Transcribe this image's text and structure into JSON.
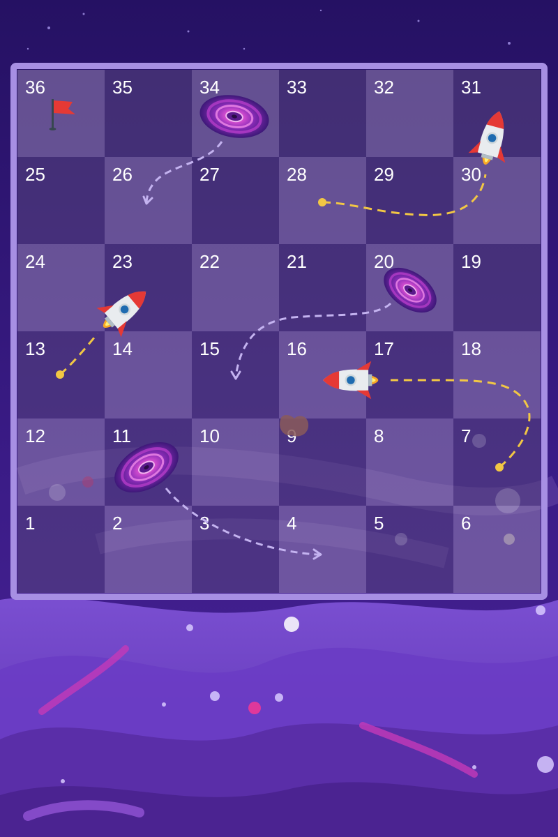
{
  "board": {
    "rows": [
      [
        "36",
        "35",
        "34",
        "33",
        "32",
        "31"
      ],
      [
        "25",
        "26",
        "27",
        "28",
        "29",
        "30"
      ],
      [
        "24",
        "23",
        "22",
        "21",
        "20",
        "19"
      ],
      [
        "13",
        "14",
        "15",
        "16",
        "17",
        "18"
      ],
      [
        "12",
        "11",
        "10",
        "9",
        "8",
        "7"
      ],
      [
        "1",
        "2",
        "3",
        "4",
        "5",
        "6"
      ]
    ]
  },
  "colors": {
    "board_border": "#a78fe3",
    "rocket_path": "#f2c744",
    "blackhole_path": "#c4b3f0",
    "flag": "#e53935"
  },
  "pieces": {
    "flag": {
      "icon": "flag-icon",
      "square": "36"
    },
    "rockets": [
      {
        "icon": "rocket-icon",
        "from": "13",
        "to": "23"
      },
      {
        "icon": "rocket-icon",
        "from": "7",
        "to": "16"
      },
      {
        "icon": "rocket-icon",
        "from": "28",
        "to": "31"
      }
    ],
    "black_holes": [
      {
        "icon": "black-hole-icon",
        "from": "34",
        "to": "26"
      },
      {
        "icon": "black-hole-icon",
        "from": "20",
        "to": "15"
      },
      {
        "icon": "black-hole-icon",
        "from": "11",
        "to": "4"
      }
    ],
    "asteroid": {
      "icon": "asteroid-icon",
      "square": "9"
    }
  }
}
